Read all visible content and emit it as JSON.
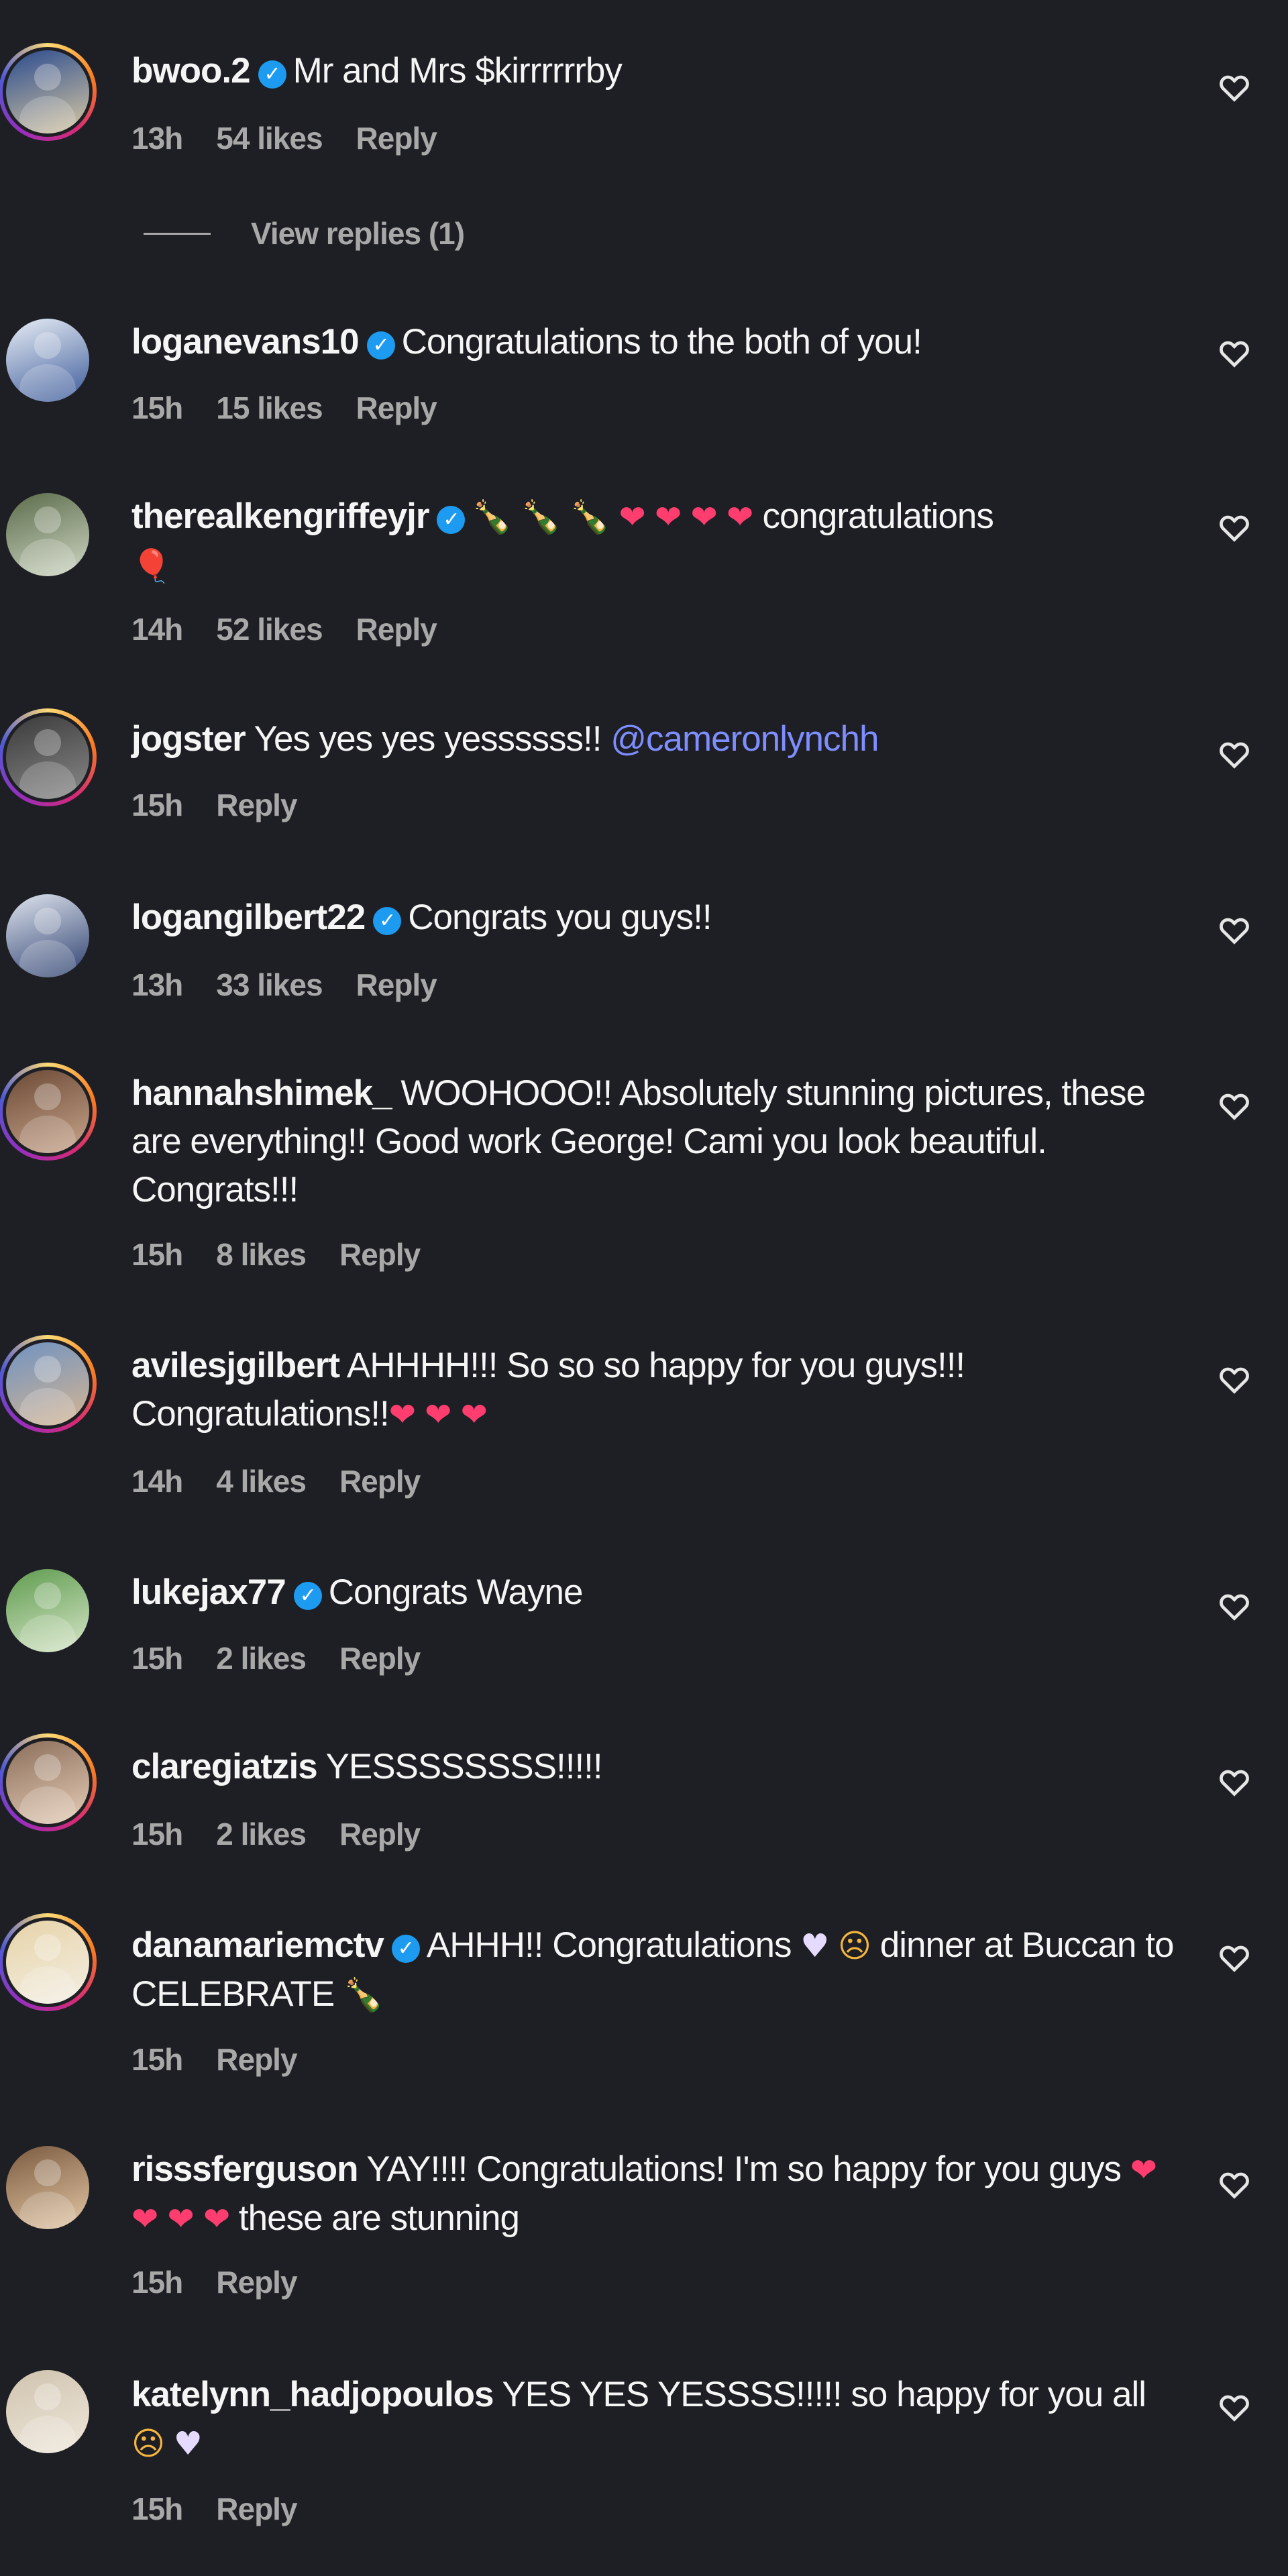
{
  "comments": [
    {
      "user": "bwoo.2",
      "verified": true,
      "text": "Mr and Mrs $kirrrrrrby",
      "time": "13h",
      "likes": "54 likes",
      "reply": "Reply",
      "avatar_colors": [
        "#2a4b8f",
        "#d9c9a3"
      ],
      "ring": true
    },
    {
      "user": "loganevans10",
      "verified": true,
      "text": "Congratulations to the both of you!",
      "time": "15h",
      "likes": "15 likes",
      "reply": "Reply",
      "avatar_colors": [
        "#e8eef5",
        "#3c5a9a"
      ],
      "ring": false
    },
    {
      "user": "therealkengriffeyjr",
      "verified": true,
      "text": "congratulations",
      "time": "14h",
      "likes": "52 likes",
      "reply": "Reply",
      "avatar_colors": [
        "#5b6b4a",
        "#cfd7c4"
      ],
      "ring": false
    },
    {
      "user": "jogster",
      "verified": false,
      "text": "Yes yes yes yessssss!!",
      "mention": "@cameronlynchh",
      "time": "15h",
      "likes": "",
      "reply": "Reply",
      "avatar_colors": [
        "#3a3a3a",
        "#8a8a8a"
      ],
      "ring": true
    },
    {
      "user": "logangilbert22",
      "verified": true,
      "text": "Congrats you guys!!",
      "time": "13h",
      "likes": "33 likes",
      "reply": "Reply",
      "avatar_colors": [
        "#dfe4ee",
        "#2c3f6e"
      ],
      "ring": false
    },
    {
      "user": "hannahshimek_",
      "verified": false,
      "text": "WOOHOOO!! Absolutely stunning pictures, these are everything!! Good work George! Cami you look beautiful. Congrats!!!",
      "time": "15h",
      "likes": "8 likes",
      "reply": "Reply",
      "avatar_colors": [
        "#6b4a36",
        "#c9a58b"
      ],
      "ring": true
    },
    {
      "user": "avilesjgilbert",
      "verified": false,
      "text": "AHHHH!!! So so so happy for you guys!!! Congratulations!!",
      "time": "14h",
      "likes": "4 likes",
      "reply": "Reply",
      "avatar_colors": [
        "#6f93c2",
        "#d6b592"
      ],
      "ring": true
    },
    {
      "user": "lukejax77",
      "verified": true,
      "text": "Congrats Wayne",
      "time": "15h",
      "likes": "2 likes",
      "reply": "Reply",
      "avatar_colors": [
        "#5f9b4f",
        "#d7e6c8"
      ],
      "ring": false
    },
    {
      "user": "claregiatzis",
      "verified": false,
      "text": "YESSSSSSSS!!!!!",
      "time": "15h",
      "likes": "2 likes",
      "reply": "Reply",
      "avatar_colors": [
        "#8a6e5a",
        "#e7cdb7"
      ],
      "ring": true
    },
    {
      "user": "danamariemctv",
      "verified": true,
      "text": "AHHH!! Congratulations",
      "text_tail": "dinner at Buccan to CELEBRATE",
      "time": "15h",
      "likes": "",
      "reply": "Reply",
      "avatar_colors": [
        "#e6d3a8",
        "#f4efe4"
      ],
      "ring": true
    },
    {
      "user": "risssferguson",
      "verified": false,
      "text": "YAY!!!! Congratulations! I'm so happy for you guys",
      "text_tail": "these are stunning",
      "time": "15h",
      "likes": "",
      "reply": "Reply",
      "avatar_colors": [
        "#7b5a3f",
        "#e3c8a6"
      ],
      "ring": false
    },
    {
      "user": "katelynn_hadjopoulos",
      "verified": false,
      "text": "YES YES YESSSS!!!!! so happy for you all",
      "time": "15h",
      "likes": "",
      "reply": "Reply",
      "avatar_colors": [
        "#cfc3ae",
        "#f0e8dc"
      ],
      "ring": false
    }
  ],
  "view_replies": "View replies (1)",
  "icons": {
    "heart": "heart-outline-icon",
    "verified": "verified-badge-icon"
  },
  "colors": {
    "background": "#1e1f24",
    "text": "#f5f5f5",
    "meta": "#a8a8a8",
    "mention": "#7e8dff",
    "verified": "#1d9bf0"
  }
}
